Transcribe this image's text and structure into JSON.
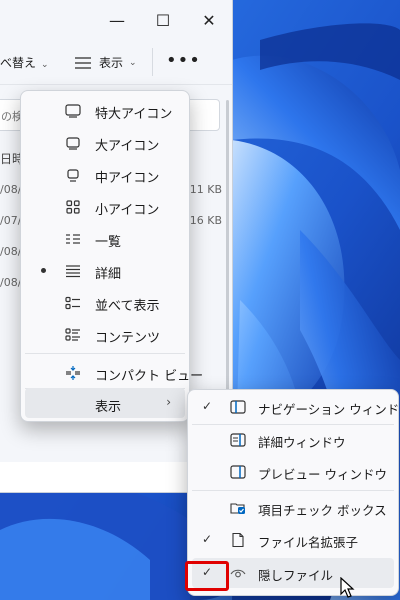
{
  "toolbar": {
    "sort_label": "べ替え",
    "view_label": "表示",
    "more_label": "•••"
  },
  "window_controls": {
    "minimize": "—",
    "maximize": "☐",
    "close": "✕"
  },
  "search": {
    "placeholder_fragment": "の検"
  },
  "column_header": {
    "date_fragment": "日時"
  },
  "file_rows": [
    {
      "date": "/08/",
      "size": "111 KB"
    },
    {
      "date": "/07/",
      "size": "16 KB"
    },
    {
      "date": "/08/",
      "size": ""
    },
    {
      "date": "/08/",
      "size": ""
    }
  ],
  "view_menu": {
    "items": [
      {
        "label": "特大アイコン",
        "icon": "monitor-large-icon"
      },
      {
        "label": "大アイコン",
        "icon": "monitor-icon"
      },
      {
        "label": "中アイコン",
        "icon": "monitor-small-icon"
      },
      {
        "label": "小アイコン",
        "icon": "grid-icon"
      },
      {
        "label": "一覧",
        "icon": "list-icon"
      },
      {
        "label": "詳細",
        "icon": "details-icon",
        "selected": true
      },
      {
        "label": "並べて表示",
        "icon": "tiles-icon"
      },
      {
        "label": "コンテンツ",
        "icon": "content-icon"
      }
    ],
    "compact_label": "コンパクト ビュー",
    "show_label": "表示",
    "show_arrow": "›"
  },
  "submenu": {
    "items": [
      {
        "label": "ナビゲーション ウィンドウ",
        "checked": true,
        "icon": "nav-pane-icon"
      },
      {
        "label": "詳細ウィンドウ",
        "checked": false,
        "icon": "details-pane-icon"
      },
      {
        "label": "プレビュー ウィンドウ",
        "checked": false,
        "icon": "preview-pane-icon"
      },
      {
        "label": "項目チェック ボックス",
        "checked": false,
        "icon": "checkbox-icon"
      },
      {
        "label": "ファイル名拡張子",
        "checked": true,
        "icon": "file-ext-icon"
      },
      {
        "label": "隠しファイル",
        "checked": true,
        "icon": "eye-icon"
      }
    ],
    "check_glyph": "✓"
  },
  "colors": {
    "accent": "#0067c0",
    "highlight_box": "#e00000"
  }
}
